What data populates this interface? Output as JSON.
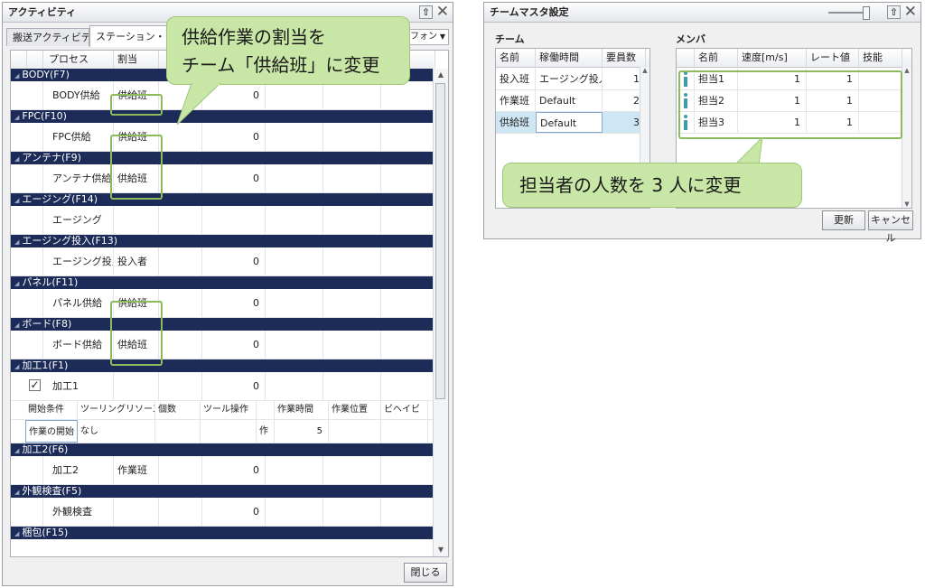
{
  "activity_window": {
    "title": "アクティビティ",
    "tabs": [
      "搬送アクティビティ",
      "ステーション・アクティ"
    ],
    "dropdown_value": "フォン",
    "columns": [
      "プロセス",
      "割当",
      "",
      "",
      "",
      "",
      ""
    ],
    "groups": [
      {
        "name": "BODY(F7)",
        "process": "BODY供給",
        "assignment": "供給班",
        "value": "0"
      },
      {
        "name": "FPC(F10)",
        "process": "FPC供給",
        "assignment": "供給班",
        "value": "0"
      },
      {
        "name": "アンテナ(F9)",
        "process": "アンテナ供給",
        "assignment": "供給班",
        "value": "0"
      },
      {
        "name": "エージング(F14)",
        "process": "エージング",
        "assignment": "",
        "value": ""
      },
      {
        "name": "エージング投入(F13)",
        "process": "エージング投入",
        "assignment": "投入者",
        "value": "0"
      },
      {
        "name": "パネル(F11)",
        "process": "パネル供給",
        "assignment": "供給班",
        "value": "0"
      },
      {
        "name": "ボード(F8)",
        "process": "ボード供給",
        "assignment": "供給班",
        "value": "0"
      },
      {
        "name": "加工1(F1)",
        "process": "加工1",
        "assignment": "",
        "value": "0"
      },
      {
        "name": "加工2(F6)",
        "process": "加工2",
        "assignment": "作業班",
        "value": "0"
      },
      {
        "name": "外観検査(F5)",
        "process": "外観検査",
        "assignment": "",
        "value": "0"
      },
      {
        "name": "梱包(F15)",
        "process": "",
        "assignment": "",
        "value": ""
      }
    ],
    "sub_table": {
      "headers": [
        "開始条件",
        "ツーリングリソース",
        "個数",
        "ツール操作",
        "",
        "作業時間",
        "作業位置",
        "ビヘイビ"
      ],
      "row": [
        "作業の開始",
        "なし",
        "",
        "",
        "作",
        "5",
        "",
        ""
      ]
    },
    "close_button": "閉じる"
  },
  "callout_left": {
    "line1": "供給作業の割当を",
    "line2": "チーム「供給班」に変更"
  },
  "team_window": {
    "title": "チームマスタ設定",
    "team_label": "チーム",
    "member_label": "メンバ",
    "team_columns": [
      "名前",
      "稼働時間",
      "要員数"
    ],
    "teams": [
      {
        "name": "投入班",
        "hours": "エージング投入",
        "count": "1"
      },
      {
        "name": "作業班",
        "hours": "Default",
        "count": "2"
      },
      {
        "name": "供給班",
        "hours": "Default",
        "count": "3"
      }
    ],
    "member_columns": [
      "",
      "名前",
      "速度[m/s]",
      "レート値",
      "技能"
    ],
    "members": [
      {
        "name": "担当1",
        "speed": "1",
        "rate": "1",
        "skill": ""
      },
      {
        "name": "担当2",
        "speed": "1",
        "rate": "1",
        "skill": ""
      },
      {
        "name": "担当3",
        "speed": "1",
        "rate": "1",
        "skill": ""
      }
    ],
    "update_button": "更新",
    "cancel_button": "キャンセル"
  },
  "callout_right": {
    "text": "担当者の人数を 3 人に変更"
  },
  "colors": {
    "group_header": "#1c2b57",
    "callout_fill": "#c8e7a6",
    "highlight_border": "#8dbb5c",
    "selected_row": "#cfe6f5"
  }
}
